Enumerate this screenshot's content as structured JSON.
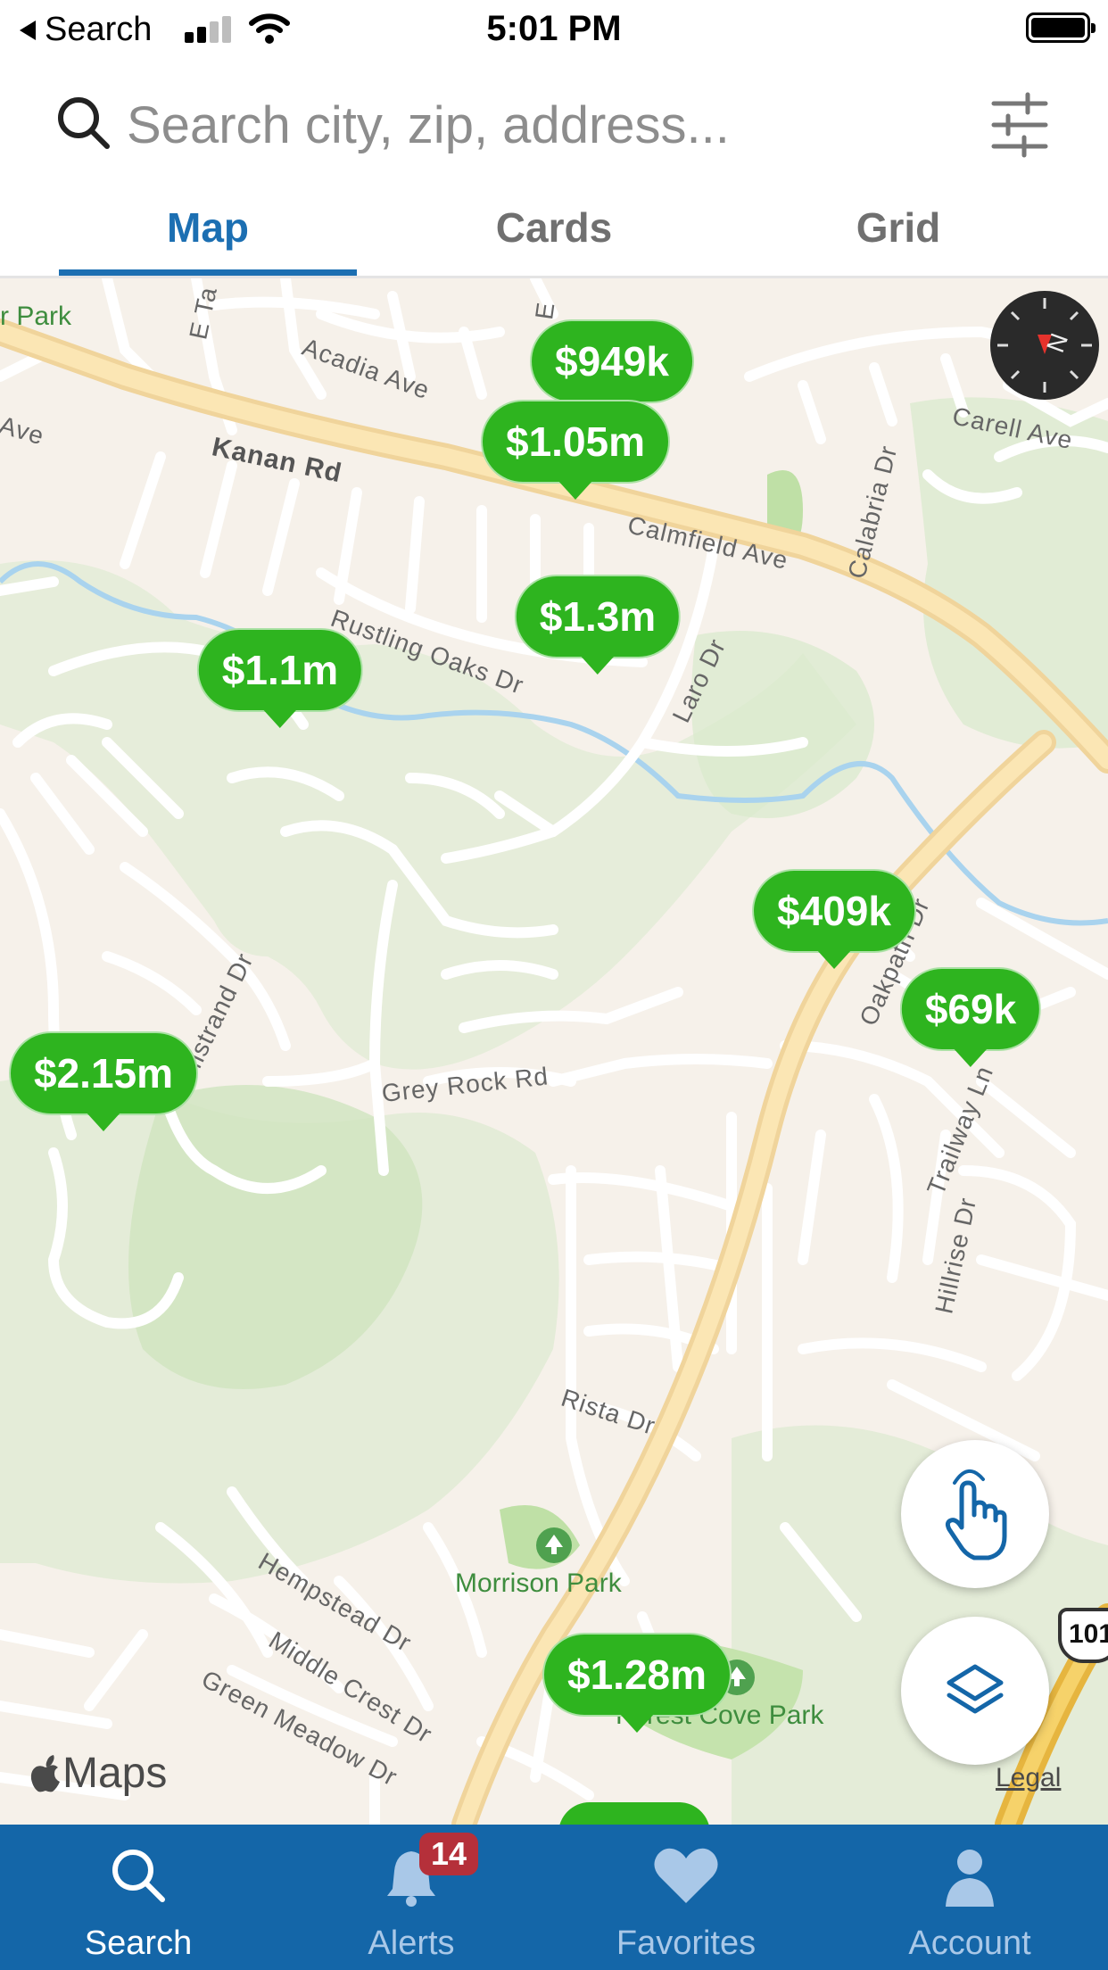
{
  "status_bar": {
    "back_label": "Search",
    "time": "5:01 PM"
  },
  "search": {
    "placeholder": "Search city, zip, address..."
  },
  "tabs": [
    {
      "label": "Map",
      "active": true
    },
    {
      "label": "Cards",
      "active": false
    },
    {
      "label": "Grid",
      "active": false
    }
  ],
  "map": {
    "streets": [
      "Acadia Ave",
      "Kanan Rd",
      "Calmfield Ave",
      "Carell Ave",
      "Calabria Dr",
      "Rustling Oaks Dr",
      "Laro Dr",
      "Oakpath Dr",
      "Grey Rock Rd",
      "Trailway Ln",
      "Hillrise Dr",
      "Rista Dr",
      "Hempstead Dr",
      "Middle Crest Dr",
      "Green Meadow Dr",
      "Ave",
      "E Ta",
      "Mistrand Dr",
      "E"
    ],
    "parks": [
      "r Park",
      "Morrison Park",
      "Forest Cove Park"
    ],
    "highway_shield": "101",
    "attribution": "Maps",
    "legal": "Legal"
  },
  "listings": [
    {
      "price": "$949k"
    },
    {
      "price": "$1.05m"
    },
    {
      "price": "$1.3m"
    },
    {
      "price": "$1.1m"
    },
    {
      "price": "$409k"
    },
    {
      "price": "$69k"
    },
    {
      "price": "$2.15m"
    },
    {
      "price": "$1.28m"
    }
  ],
  "bottom_nav": [
    {
      "label": "Search",
      "icon": "search-icon",
      "active": true
    },
    {
      "label": "Alerts",
      "icon": "bell-icon",
      "active": false,
      "badge": "14"
    },
    {
      "label": "Favorites",
      "icon": "heart-icon",
      "active": false
    },
    {
      "label": "Account",
      "icon": "person-icon",
      "active": false
    }
  ],
  "colors": {
    "brand_blue": "#1466a8",
    "tab_active": "#1c6fb2",
    "pin_green": "#2eb41f",
    "badge_red": "#b5303a"
  }
}
